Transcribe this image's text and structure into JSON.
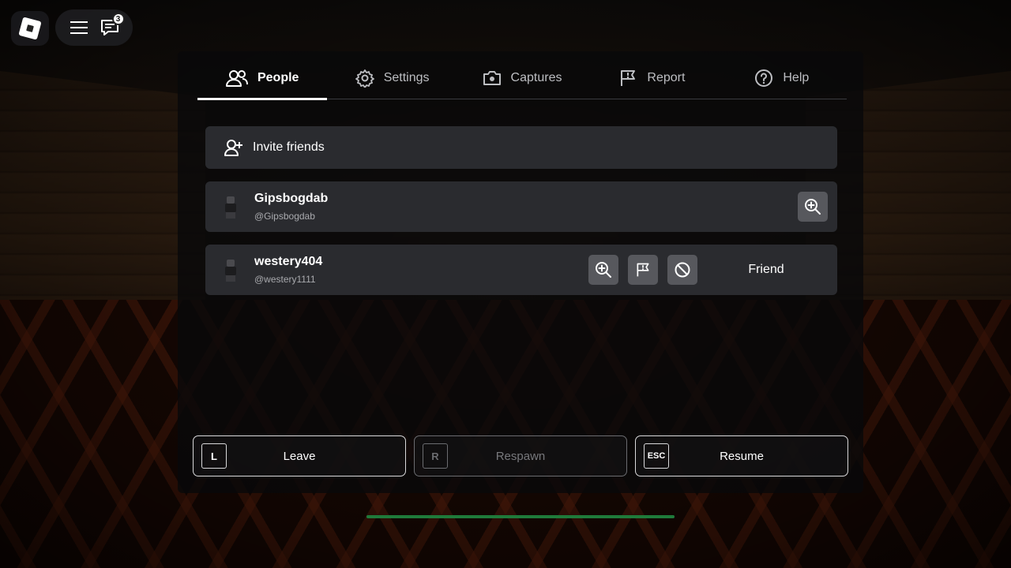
{
  "topbar": {
    "logo_icon": "roblox-logo",
    "menu_icon": "hamburger-menu-icon",
    "chat_icon": "chat-icon",
    "chat_badge": "3"
  },
  "tabs": [
    {
      "label": "People",
      "icon": "people-icon",
      "active": true
    },
    {
      "label": "Settings",
      "icon": "gear-icon",
      "active": false
    },
    {
      "label": "Captures",
      "icon": "camera-icon",
      "active": false
    },
    {
      "label": "Report",
      "icon": "flag-icon",
      "active": false
    },
    {
      "label": "Help",
      "icon": "help-icon",
      "active": false
    }
  ],
  "invite": {
    "label": "Invite friends",
    "icon": "add-friend-icon"
  },
  "players": [
    {
      "display_name": "Gipsbogdab",
      "username": "@Gipsbogdab",
      "actions": [
        "inspect"
      ]
    },
    {
      "display_name": "westery404",
      "username": "@westery1111",
      "actions": [
        "inspect",
        "report",
        "block"
      ],
      "friend_label": "Friend"
    }
  ],
  "bottom_buttons": [
    {
      "key": "L",
      "label": "Leave",
      "enabled": true
    },
    {
      "key": "R",
      "label": "Respawn",
      "enabled": false
    },
    {
      "key": "ESC",
      "label": "Resume",
      "enabled": true
    }
  ],
  "progress": {
    "value": 1.0,
    "color": "#1f7a3a"
  },
  "colors": {
    "panel": "#2a2b2f",
    "action_button": "#57585d",
    "accent": "#ffffff"
  }
}
